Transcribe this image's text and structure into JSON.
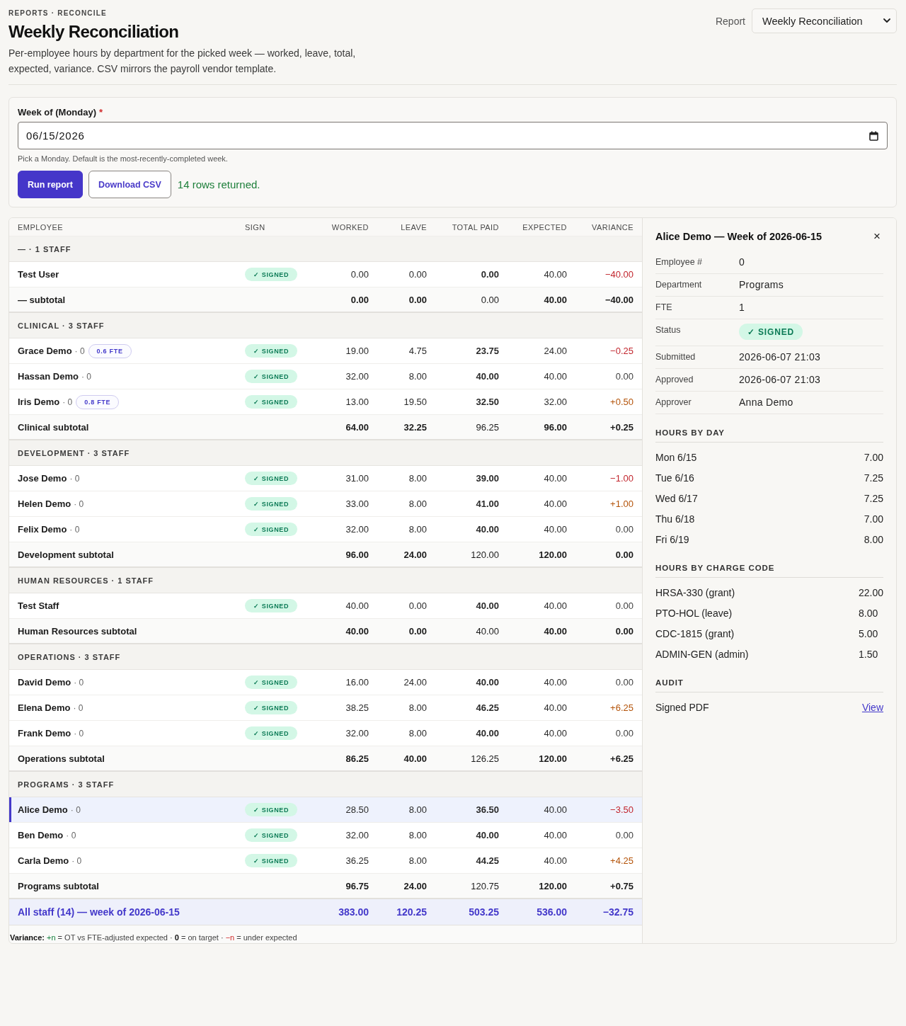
{
  "breadcrumb": "REPORTS · RECONCILE",
  "title": "Weekly Reconciliation",
  "description": "Per-employee hours by department for the picked week — worked, leave, total, expected, variance. CSV mirrors the payroll vendor template.",
  "report_picker": {
    "label": "Report",
    "value": "Weekly Reconciliation"
  },
  "week_form": {
    "label": "Week of (Monday)",
    "required_mark": "*",
    "value": "06/15/2026",
    "hint": "Pick a Monday. Default is the most-recently-completed week.",
    "buttons": [
      {
        "label": "Run report",
        "kind": "primary"
      },
      {
        "label": "Download CSV",
        "kind": "secondary"
      }
    ],
    "status": "14 rows returned."
  },
  "table": {
    "columns": [
      "EMPLOYEE",
      "SIGN",
      "WORKED",
      "LEAVE",
      "TOTAL PAID",
      "EXPECTED",
      "VARIANCE"
    ],
    "groups": [
      {
        "title": "— · 1 STAFF",
        "rows": [
          {
            "kind": "under",
            "name": "Test User",
            "sign": {
              "kind": "signed",
              "label": "✓ SIGNED"
            },
            "worked": "0.00",
            "leave": "0.00",
            "total_paid": "0.00",
            "expected": "40.00",
            "variance": "−40.00",
            "selected": false
          }
        ],
        "subtotal": {
          "label": "— subtotal",
          "worked": "0.00",
          "leave": "0.00",
          "total_paid": "0.00",
          "expected": "40.00",
          "variance": "−40.00"
        }
      },
      {
        "title": "CLINICAL · 3 STAFF",
        "rows": [
          {
            "kind": "under",
            "name": "Grace Demo",
            "number": "· 0",
            "fte": "0.6 FTE",
            "sign": {
              "kind": "signed",
              "label": "✓ SIGNED"
            },
            "worked": "19.00",
            "leave": "4.75",
            "total_paid": "23.75",
            "expected": "24.00",
            "variance": "−0.25",
            "selected": false
          },
          {
            "kind": "on",
            "name": "Hassan Demo",
            "number": "· 0",
            "sign": {
              "kind": "signed",
              "label": "✓ SIGNED"
            },
            "worked": "32.00",
            "leave": "8.00",
            "total_paid": "40.00",
            "expected": "40.00",
            "variance": "0.00",
            "selected": false
          },
          {
            "kind": "over",
            "name": "Iris Demo",
            "number": "· 0",
            "fte": "0.8 FTE",
            "sign": {
              "kind": "signed",
              "label": "✓ SIGNED"
            },
            "worked": "13.00",
            "leave": "19.50",
            "total_paid": "32.50",
            "expected": "32.00",
            "variance": "+0.50",
            "selected": false
          }
        ],
        "subtotal": {
          "label": "Clinical subtotal",
          "worked": "64.00",
          "leave": "32.25",
          "total_paid": "96.25",
          "expected": "96.00",
          "variance": "+0.25"
        }
      },
      {
        "title": "DEVELOPMENT · 3 STAFF",
        "rows": [
          {
            "kind": "under",
            "name": "Jose Demo",
            "number": "· 0",
            "sign": {
              "kind": "signed",
              "label": "✓ SIGNED"
            },
            "worked": "31.00",
            "leave": "8.00",
            "total_paid": "39.00",
            "expected": "40.00",
            "variance": "−1.00",
            "selected": false
          },
          {
            "kind": "over",
            "name": "Helen Demo",
            "number": "· 0",
            "sign": {
              "kind": "signed",
              "label": "✓ SIGNED"
            },
            "worked": "33.00",
            "leave": "8.00",
            "total_paid": "41.00",
            "expected": "40.00",
            "variance": "+1.00",
            "selected": false
          },
          {
            "kind": "on",
            "name": "Felix Demo",
            "number": "· 0",
            "sign": {
              "kind": "signed",
              "label": "✓ SIGNED"
            },
            "worked": "32.00",
            "leave": "8.00",
            "total_paid": "40.00",
            "expected": "40.00",
            "variance": "0.00",
            "selected": false
          }
        ],
        "subtotal": {
          "label": "Development subtotal",
          "worked": "96.00",
          "leave": "24.00",
          "total_paid": "120.00",
          "expected": "120.00",
          "variance": "0.00"
        }
      },
      {
        "title": "HUMAN RESOURCES · 1 STAFF",
        "rows": [
          {
            "kind": "on",
            "name": "Test Staff",
            "sign": {
              "kind": "signed",
              "label": "✓ SIGNED"
            },
            "worked": "40.00",
            "leave": "0.00",
            "total_paid": "40.00",
            "expected": "40.00",
            "variance": "0.00",
            "selected": false
          }
        ],
        "subtotal": {
          "label": "Human Resources subtotal",
          "worked": "40.00",
          "leave": "0.00",
          "total_paid": "40.00",
          "expected": "40.00",
          "variance": "0.00"
        }
      },
      {
        "title": "OPERATIONS · 3 STAFF",
        "rows": [
          {
            "kind": "on",
            "name": "David Demo",
            "number": "· 0",
            "sign": {
              "kind": "signed",
              "label": "✓ SIGNED"
            },
            "worked": "16.00",
            "leave": "24.00",
            "total_paid": "40.00",
            "expected": "40.00",
            "variance": "0.00",
            "selected": false
          },
          {
            "kind": "over",
            "name": "Elena Demo",
            "number": "· 0",
            "sign": {
              "kind": "signed",
              "label": "✓ SIGNED"
            },
            "worked": "38.25",
            "leave": "8.00",
            "total_paid": "46.25",
            "expected": "40.00",
            "variance": "+6.25",
            "selected": false
          },
          {
            "kind": "on",
            "name": "Frank Demo",
            "number": "· 0",
            "sign": {
              "kind": "signed",
              "label": "✓ SIGNED"
            },
            "worked": "32.00",
            "leave": "8.00",
            "total_paid": "40.00",
            "expected": "40.00",
            "variance": "0.00",
            "selected": false
          }
        ],
        "subtotal": {
          "label": "Operations subtotal",
          "worked": "86.25",
          "leave": "40.00",
          "total_paid": "126.25",
          "expected": "120.00",
          "variance": "+6.25"
        }
      },
      {
        "title": "PROGRAMS · 3 STAFF",
        "rows": [
          {
            "kind": "under",
            "name": "Alice Demo",
            "number": "· 0",
            "sign": {
              "kind": "signed",
              "label": "✓ SIGNED"
            },
            "worked": "28.50",
            "leave": "8.00",
            "total_paid": "36.50",
            "expected": "40.00",
            "variance": "−3.50",
            "selected": true
          },
          {
            "kind": "on",
            "name": "Ben Demo",
            "number": "· 0",
            "sign": {
              "kind": "signed",
              "label": "✓ SIGNED"
            },
            "worked": "32.00",
            "leave": "8.00",
            "total_paid": "40.00",
            "expected": "40.00",
            "variance": "0.00",
            "selected": false
          },
          {
            "kind": "over",
            "name": "Carla Demo",
            "number": "· 0",
            "sign": {
              "kind": "signed",
              "label": "✓ SIGNED"
            },
            "worked": "36.25",
            "leave": "8.00",
            "total_paid": "44.25",
            "expected": "40.00",
            "variance": "+4.25",
            "selected": false
          }
        ],
        "subtotal": {
          "label": "Programs subtotal",
          "worked": "96.75",
          "leave": "24.00",
          "total_paid": "120.75",
          "expected": "120.00",
          "variance": "+0.75"
        }
      }
    ],
    "total": {
      "label": "All staff (14) — week of 2026-06-15",
      "worked": "383.00",
      "leave": "120.25",
      "total_paid": "503.25",
      "expected": "536.00",
      "variance": "−32.75"
    },
    "legend": [
      {
        "kind": "label",
        "text": "Variance:"
      },
      {
        "kind": "plus",
        "text": "+n"
      },
      {
        "kind": "text",
        "text": "= OT vs FTE-adjusted expected ·"
      },
      {
        "kind": "zero",
        "text": "0"
      },
      {
        "kind": "text",
        "text": "= on target ·"
      },
      {
        "kind": "minus",
        "text": "−n"
      },
      {
        "kind": "text",
        "text": "= under expected"
      }
    ]
  },
  "panel": {
    "title": "Alice Demo — Week of 2026-06-15",
    "close": "×",
    "fields": [
      {
        "label": "Employee #",
        "kind": "text",
        "value": "0"
      },
      {
        "label": "Department",
        "kind": "text",
        "value": "Programs"
      },
      {
        "label": "FTE",
        "kind": "text",
        "value": "1"
      },
      {
        "label": "Status",
        "kind": "badge",
        "value": "✓ SIGNED"
      },
      {
        "label": "Submitted",
        "kind": "text",
        "value": "2026-06-07 21:03"
      },
      {
        "label": "Approved",
        "kind": "text",
        "value": "2026-06-07 21:03"
      },
      {
        "label": "Approver",
        "kind": "text",
        "value": "Anna Demo"
      }
    ],
    "sections": [
      {
        "title": "HOURS BY DAY",
        "kind": "hours",
        "rows": [
          {
            "label": "Mon 6/15",
            "value": "7.00"
          },
          {
            "label": "Tue 6/16",
            "value": "7.25"
          },
          {
            "label": "Wed 6/17",
            "value": "7.25"
          },
          {
            "label": "Thu 6/18",
            "value": "7.00"
          },
          {
            "label": "Fri 6/19",
            "value": "8.00"
          }
        ]
      },
      {
        "title": "HOURS BY CHARGE CODE",
        "kind": "hours",
        "rows": [
          {
            "label": "HRSA-330 (grant)",
            "value": "22.00"
          },
          {
            "label": "PTO-HOL (leave)",
            "value": "8.00"
          },
          {
            "label": "CDC-1815 (grant)",
            "value": "5.00"
          },
          {
            "label": "ADMIN-GEN (admin)",
            "value": "1.50"
          }
        ]
      },
      {
        "title": "AUDIT",
        "kind": "links",
        "rows": [
          {
            "label": "Signed PDF",
            "value": "View"
          }
        ]
      }
    ]
  }
}
